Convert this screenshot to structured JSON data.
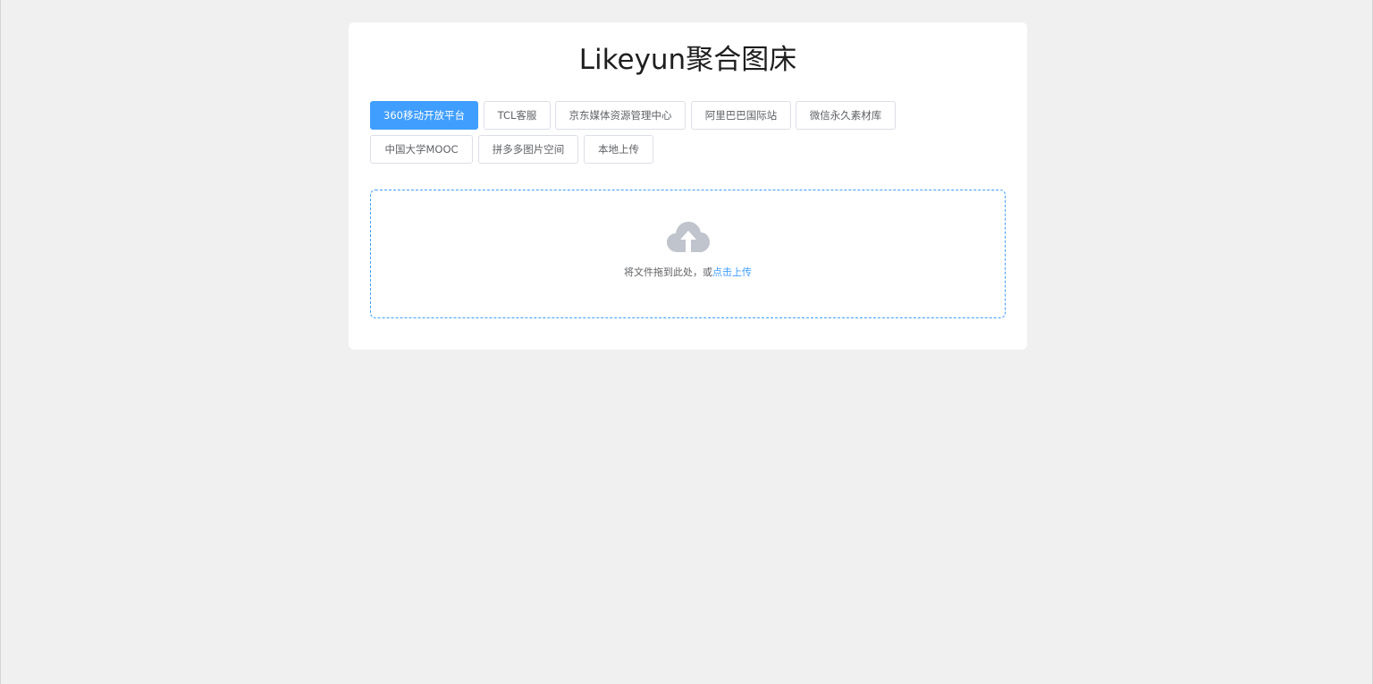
{
  "app": {
    "title": "Likeyun聚合图床"
  },
  "tabs": [
    {
      "label": "360移动开放平台",
      "active": true
    },
    {
      "label": "TCL客服",
      "active": false
    },
    {
      "label": "京东媒体资源管理中心",
      "active": false
    },
    {
      "label": "阿里巴巴国际站",
      "active": false
    },
    {
      "label": "微信永久素材库",
      "active": false
    },
    {
      "label": "中国大学MOOC",
      "active": false
    },
    {
      "label": "拼多多图片空间",
      "active": false
    },
    {
      "label": "本地上传",
      "active": false
    }
  ],
  "upload": {
    "icon": "cloud-upload-icon",
    "hint_text": "将文件拖到此处，或",
    "hint_link": "点击上传"
  },
  "colors": {
    "accent": "#409eff",
    "icon": "#c0c4cc",
    "background": "#f0f0f0"
  }
}
